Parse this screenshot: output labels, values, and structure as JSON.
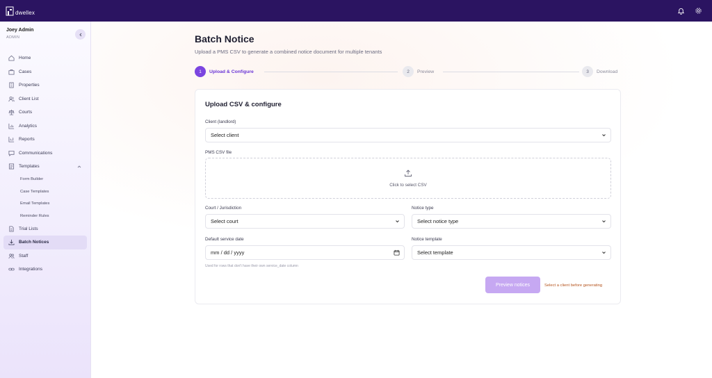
{
  "app": {
    "logo_text": "dwellex",
    "colors": {
      "topbar": "#2b1461",
      "accent": "#7b45e0"
    }
  },
  "topbar": {
    "icons": [
      "bell-icon",
      "gear-icon"
    ]
  },
  "user": {
    "name": "Joey Admin",
    "role": "ADMIN"
  },
  "sidebar": {
    "items": [
      {
        "label": "Home",
        "icon": "home-icon"
      },
      {
        "label": "Cases",
        "icon": "briefcase-icon"
      },
      {
        "label": "Properties",
        "icon": "building-icon"
      },
      {
        "label": "Client List",
        "icon": "users-icon"
      },
      {
        "label": "Courts",
        "icon": "scale-icon"
      },
      {
        "label": "Analytics",
        "icon": "chart-icon"
      },
      {
        "label": "Reports",
        "icon": "report-icon"
      },
      {
        "label": "Communications",
        "icon": "chat-icon"
      },
      {
        "label": "Templates",
        "icon": "template-icon"
      },
      {
        "label": "Trial Lists",
        "icon": "file-icon"
      },
      {
        "label": "Batch Notices",
        "icon": "download-icon",
        "active": true
      },
      {
        "label": "Staff",
        "icon": "staff-icon"
      },
      {
        "label": "Integrations",
        "icon": "link-icon"
      }
    ],
    "sub_items": [
      "Form Builder",
      "Case Templates",
      "Email Templates",
      "Reminder Rules"
    ]
  },
  "page": {
    "title": "Batch Notice",
    "subtitle": "Upload a PMS CSV to generate a combined notice document for multiple tenants"
  },
  "stepper": {
    "steps": [
      {
        "number": "1",
        "label": "Upload & Configure",
        "active": true
      },
      {
        "number": "2",
        "label": "Preview",
        "active": false
      },
      {
        "number": "3",
        "label": "Download",
        "active": false
      }
    ]
  },
  "form": {
    "title": "Upload CSV & configure",
    "client": {
      "label": "Client (landlord)",
      "value": "Select client"
    },
    "csv": {
      "label": "PMS CSV file",
      "dropzone_text": "Click to select CSV"
    },
    "court": {
      "label": "Court / Jurisdiction",
      "value": "Select court"
    },
    "notice_type": {
      "label": "Notice type",
      "value": "Select notice type"
    },
    "service_date": {
      "label": "Default service date",
      "placeholder": "mm / dd / yyyy",
      "hint": "Used for rows that don't have their own service_date column"
    },
    "template": {
      "label": "Notice template",
      "value": "Select template"
    },
    "preview_button": "Preview notices",
    "warning": "Select a client before generating"
  }
}
